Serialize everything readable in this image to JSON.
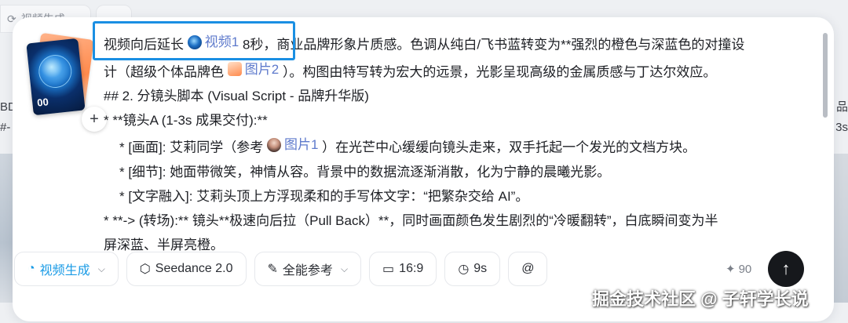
{
  "background": {
    "chip_text": "视频生成",
    "left_text": [
      "BD",
      "#-"
    ],
    "right_text": [
      "品",
      "3s"
    ]
  },
  "composer": {
    "thumbnail_caption": "00",
    "add_label": "+",
    "lines": {
      "l1_a": "视频向后延长",
      "l1_ref": "视频1",
      "l1_b": "8秒，商业品牌形象片质感。色调从纯白/飞书蓝转变为**强烈的橙色与深蓝色的对撞设",
      "l2_a": "计（超级个体品牌色",
      "l2_ref": "图片2",
      "l2_b": "）。构图由特写转为宏大的远景，光影呈现高级的金属质感与丁达尔效应。",
      "l3": "## 2. 分镜头脚本 (Visual Script - 品牌升华版)",
      "l4": "*   **镜头A (1-3s 成果交付):**",
      "l5_a": "*     [画面]: 艾莉同学（参考",
      "l5_ref": "图片1",
      "l5_b": "）在光芒中心缓缓向镜头走来，双手托起一个发光的文档方块。",
      "l6": "*     [细节]: 她面带微笑，神情从容。背景中的数据流逐渐消散，化为宁静的晨曦光影。",
      "l7": "*     [文字融入]: 艾莉头顶上方浮现柔和的手写体文字：“把繁杂交给 AI”。",
      "l8": "*   **-> (转场):** 镜头**极速向后拉（Pull Back）**，同时画面颜色发生剧烈的“冷暖翻转”，白底瞬间变为半",
      "l9": "屏深蓝、半屏亮橙。"
    }
  },
  "toolbar": {
    "mode_label": "视频生成",
    "model_label": "Seedance 2.0",
    "reference_label": "全能参考",
    "ratio_label": "16:9",
    "duration_label": "9s",
    "mention_label": "@",
    "credits": "90",
    "send_icon": "arrow-up-icon"
  },
  "watermark": "掘金技术社区 @ 子轩学长说",
  "colors": {
    "accent": "#1a9be6",
    "highlight_border": "#1a8fe3",
    "reference_link": "#5e7acc"
  }
}
